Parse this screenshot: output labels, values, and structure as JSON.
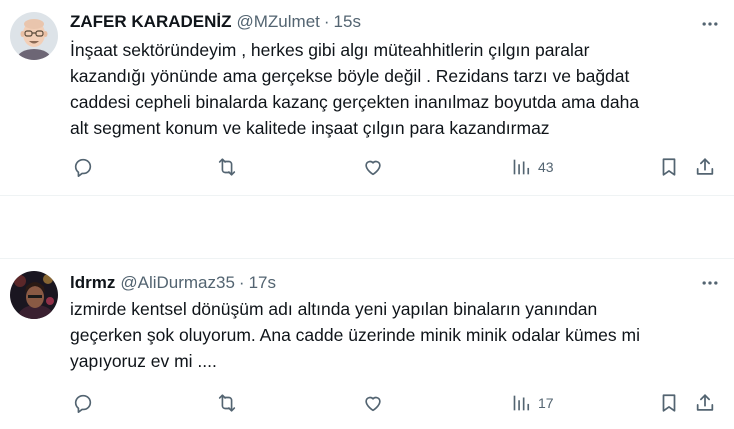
{
  "colors": {
    "text": "#0f1419",
    "muted": "#536471",
    "divider": "#eff3f4"
  },
  "tweets": [
    {
      "name": "ZAFER KARADENİZ",
      "handle": "@MZulmet",
      "separator": "·",
      "time": "15s",
      "lines": [
        "İnşaat sektöründeyim , herkes gibi algı müteahhitlerin çılgın paralar",
        "kazandığı yönünde ama gerçekse böyle değil . Rezidans tarzı ve bağdat",
        "caddesi cepheli binalarda kazanç gerçekten inanılmaz boyutda ama daha",
        "alt segment konum ve kalitede inşaat çılgın para kazandırmaz"
      ],
      "views": "43",
      "icons": [
        "more-icon",
        "reply-icon",
        "repost-icon",
        "like-icon",
        "views-icon",
        "bookmark-icon",
        "share-icon"
      ]
    },
    {
      "name": "ldrmz",
      "handle": "@AliDurmaz35",
      "separator": "·",
      "time": "17s",
      "lines": [
        "izmirde kentsel dönüşüm adı altında yeni yapılan binaların yanından",
        "geçerken şok oluyorum. Ana cadde üzerinde minik minik odalar kümes mi",
        "yapıyoruz ev mi ...."
      ],
      "views": "17",
      "icons": [
        "more-icon",
        "reply-icon",
        "repost-icon",
        "like-icon",
        "views-icon",
        "bookmark-icon",
        "share-icon"
      ]
    }
  ]
}
